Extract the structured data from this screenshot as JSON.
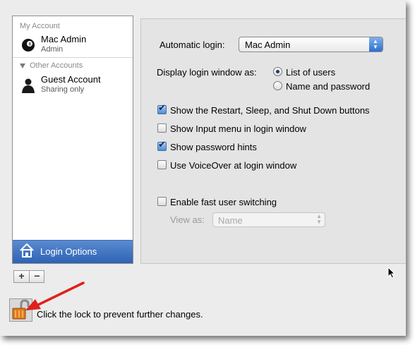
{
  "sidebar": {
    "my_account_header": "My Account",
    "my_account": {
      "name": "Mac Admin",
      "role": "Admin"
    },
    "other_accounts_header": "Other Accounts",
    "other_accounts": [
      {
        "name": "Guest Account",
        "role": "Sharing only"
      }
    ],
    "login_options_label": "Login Options",
    "add_label": "+",
    "remove_label": "−"
  },
  "main": {
    "automatic_login_label": "Automatic login:",
    "automatic_login_value": "Mac Admin",
    "display_login_label": "Display login window as:",
    "radio_options": [
      "List of users",
      "Name and password"
    ],
    "radio_selected": "List of users",
    "checkboxes": [
      {
        "label": "Show the Restart, Sleep, and Shut Down buttons",
        "checked": true
      },
      {
        "label": "Show Input menu in login window",
        "checked": false
      },
      {
        "label": "Show password hints",
        "checked": true
      },
      {
        "label": "Use VoiceOver at login window",
        "checked": false
      }
    ],
    "fast_switching_label": "Enable fast user switching",
    "fast_switching_checked": false,
    "view_as_label": "View as:",
    "view_as_value": "Name"
  },
  "footer": {
    "lock_caption": "Click the lock to prevent further changes."
  },
  "icons": {
    "admin_avatar": "eight-ball-icon",
    "guest_avatar": "person-silhouette-icon",
    "login_options": "house-icon",
    "lock": "padlock-open-icon",
    "annotation": "red-arrow-icon",
    "cursor": "mouse-pointer-icon"
  },
  "colors": {
    "selection": "#2e62b4",
    "checkbox_checked": "#4d8ad9",
    "annotation_arrow": "#e0201c"
  }
}
